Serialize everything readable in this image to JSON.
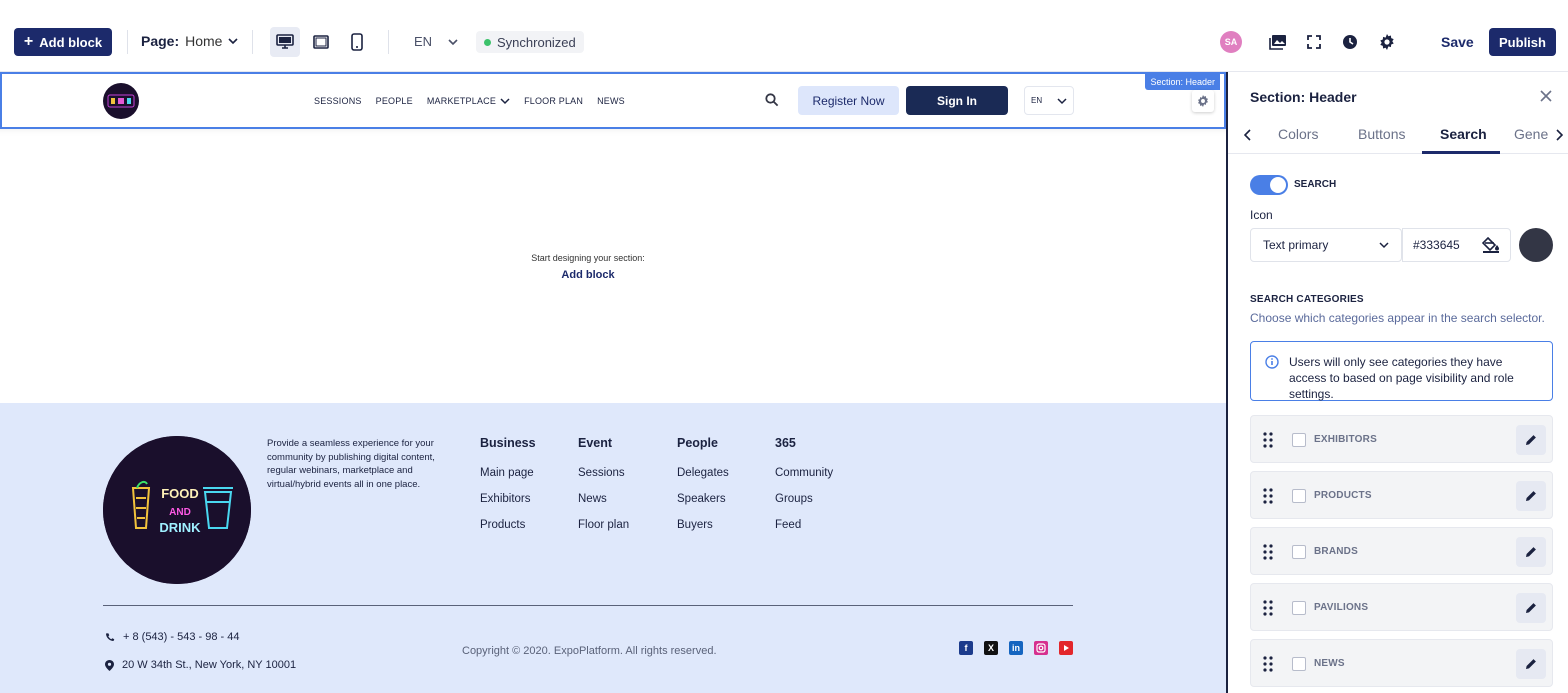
{
  "toolbar": {
    "add_block": "Add block",
    "page_label": "Page:",
    "page_value": "Home",
    "lang": "EN",
    "sync": "Synchronized",
    "avatar": "SA",
    "save": "Save",
    "publish": "Publish"
  },
  "site": {
    "section_tag": "Section: Header",
    "nav": [
      "SESSIONS",
      "PEOPLE",
      "MARKETPLACE",
      "FLOOR PLAN",
      "NEWS"
    ],
    "register": "Register Now",
    "sign_in": "Sign In",
    "lang": "EN",
    "empty_hint": "Start designing your section:",
    "empty_add": "Add block",
    "logo_words": [
      "FOOD",
      "AND",
      "DRINK"
    ],
    "footer": {
      "description": "Provide a seamless experience for your community by publishing digital content, regular webinars, marketplace and virtual/hybrid events all in one place.",
      "columns": [
        {
          "title": "Business",
          "items": [
            "Main page",
            "Exhibitors",
            "Products"
          ]
        },
        {
          "title": "Event",
          "items": [
            "Sessions",
            "News",
            "Floor plan"
          ]
        },
        {
          "title": "People",
          "items": [
            "Delegates",
            "Speakers",
            "Buyers"
          ]
        },
        {
          "title": "365",
          "items": [
            "Community",
            "Groups",
            "Feed"
          ]
        }
      ],
      "phone": "+ 8 (543) - 543 - 98 - 44",
      "address": "20 W 34th St., New York, NY 10001",
      "copyright": "Copyright © 2020. ExpoPlatform. All rights reserved."
    }
  },
  "panel": {
    "title": "Section: Header",
    "tabs": [
      "Colors",
      "Buttons",
      "Search",
      "Gene"
    ],
    "active_tab": "Search",
    "toggle_label": "SEARCH",
    "toggle_on": true,
    "icon_label": "Icon",
    "icon_color_select": "Text primary",
    "icon_hex": "#333645",
    "categories_title": "SEARCH CATEGORIES",
    "categories_subtitle": "Choose which categories appear in the search selector.",
    "info": "Users will only see categories they have access to based on page visibility and role settings.",
    "categories": [
      "EXHIBITORS",
      "PRODUCTS",
      "BRANDS",
      "PAVILIONS",
      "NEWS"
    ]
  },
  "colors": {
    "primary": "#1c2a6b",
    "accent": "#4a7fe6",
    "footer_bg": "#dfe8fb",
    "icon_swatch": "#333645"
  }
}
